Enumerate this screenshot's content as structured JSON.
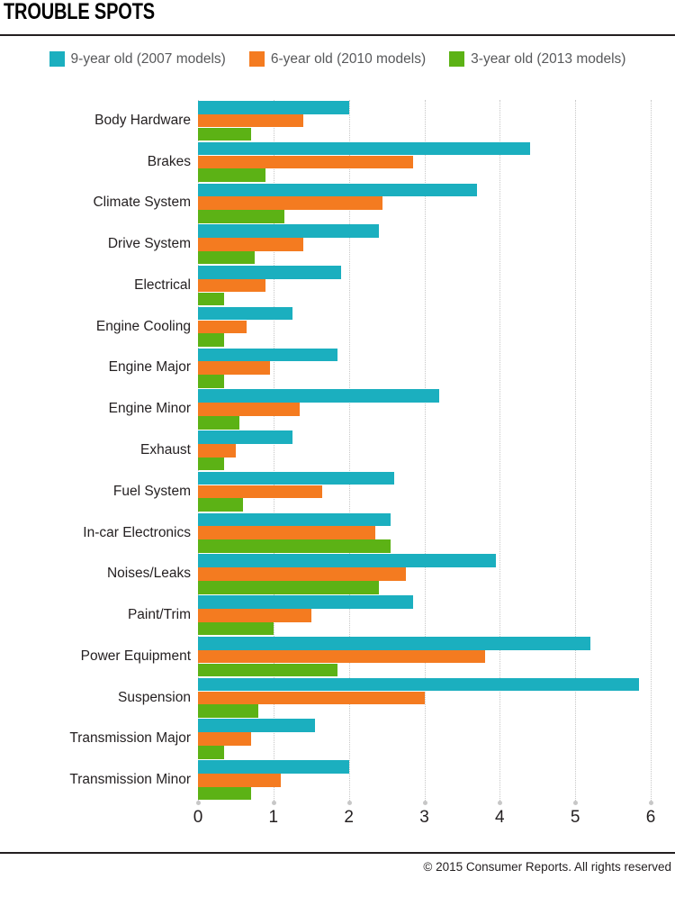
{
  "header": {
    "title": "TROUBLE SPOTS"
  },
  "footer": {
    "copyright": "© 2015 Consumer Reports. All rights reserved"
  },
  "legend": {
    "items": [
      {
        "label": "9-year old (2007 models)",
        "color": "#1bafbf",
        "icon": "legend-swatch-teal"
      },
      {
        "label": "6-year old (2010 models)",
        "color": "#f47b20",
        "icon": "legend-swatch-orange"
      },
      {
        "label": "3-year old (2013 models)",
        "color": "#5cb215",
        "icon": "legend-swatch-green"
      }
    ]
  },
  "chart_data": {
    "type": "bar",
    "orientation": "horizontal",
    "title": "TROUBLE SPOTS",
    "xlabel": "",
    "ylabel": "",
    "xlim": [
      0,
      6
    ],
    "xticks": [
      0,
      1,
      2,
      3,
      4,
      5,
      6
    ],
    "xtick_labels": [
      "0",
      "1",
      "2",
      "3",
      "4",
      "5",
      "6"
    ],
    "grid": true,
    "grid_axis": "x",
    "grid_style": "dotted",
    "legend_position": "top-center",
    "categories": [
      "Body Hardware",
      "Brakes",
      "Climate System",
      "Drive System",
      "Electrical",
      "Engine Cooling",
      "Engine Major",
      "Engine Minor",
      "Exhaust",
      "Fuel System",
      "In-car Electronics",
      "Noises/Leaks",
      "Paint/Trim",
      "Power Equipment",
      "Suspension",
      "Transmission Major",
      "Transmission Minor"
    ],
    "series": [
      {
        "name": "9-year old (2007 models)",
        "color": "#1bafbf",
        "values": [
          2.0,
          4.4,
          3.7,
          2.4,
          1.9,
          1.25,
          1.85,
          3.2,
          1.25,
          2.6,
          2.55,
          3.95,
          2.85,
          5.2,
          5.85,
          1.55,
          2.0
        ]
      },
      {
        "name": "6-year old (2010 models)",
        "color": "#f47b20",
        "values": [
          1.4,
          2.85,
          2.45,
          1.4,
          0.9,
          0.65,
          0.95,
          1.35,
          0.5,
          1.65,
          2.35,
          2.75,
          1.5,
          3.8,
          3.0,
          0.7,
          1.1
        ]
      },
      {
        "name": "3-year old (2013 models)",
        "color": "#5cb215",
        "values": [
          0.7,
          0.9,
          1.15,
          0.75,
          0.35,
          0.35,
          0.35,
          0.55,
          0.35,
          0.6,
          2.55,
          2.4,
          1.0,
          1.85,
          0.8,
          0.35,
          0.7
        ]
      }
    ]
  }
}
